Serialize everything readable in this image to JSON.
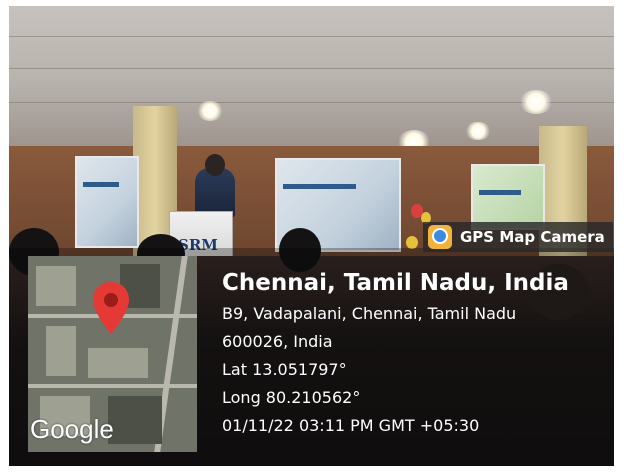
{
  "badge": {
    "label": "GPS Map Camera",
    "icon": "gps-map-camera-app-icon"
  },
  "location": {
    "title": "Chennai, Tamil Nadu, India",
    "address_line1": "B9, Vadapalani, Chennai, Tamil Nadu",
    "address_line2": "600026, India",
    "lat": "Lat 13.051797°",
    "long": "Long 80.210562°",
    "datetime": "01/11/22 03:11 PM GMT +05:30"
  },
  "map": {
    "attribution": "Google",
    "pin_icon": "location-pin-icon",
    "pin_color": "#e53935"
  },
  "scene": {
    "podium_text": "SRM"
  }
}
